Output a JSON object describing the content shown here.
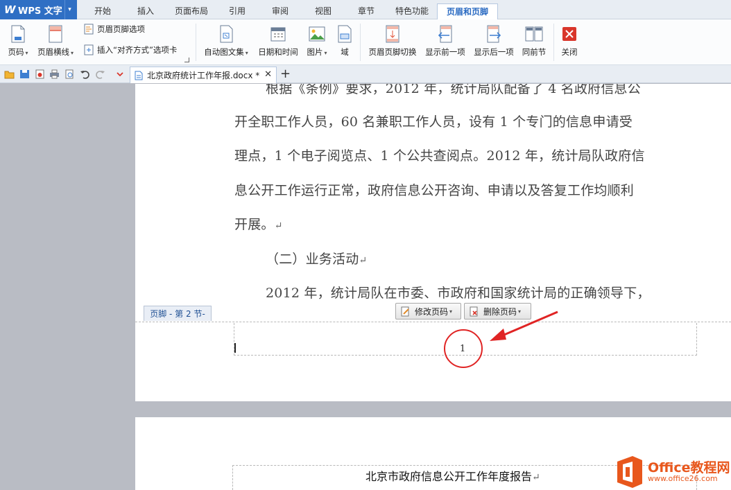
{
  "app": {
    "name": "WPS 文字"
  },
  "menu": {
    "tabs": [
      "开始",
      "插入",
      "页面布局",
      "引用",
      "审阅",
      "视图",
      "章节",
      "特色功能",
      "页眉和页脚"
    ],
    "active": "页眉和页脚"
  },
  "ribbon": {
    "page_number": "页码",
    "header_line": "页眉横线",
    "header_footer_options": "页眉页脚选项",
    "insert_align_tab": "插入“对齐方式”选项卡",
    "auto_text": "自动图文集",
    "date_time": "日期和时间",
    "picture": "图片",
    "field": "域",
    "switch_header_footer": "页眉页脚切换",
    "show_previous": "显示前一项",
    "show_next": "显示后一项",
    "same_as_previous": "同前节",
    "close": "关闭"
  },
  "document_tab": {
    "filename": "北京政府统计工作年报.docx *"
  },
  "document": {
    "lines": [
      "根据《条例》要求，2012 年，统计局队配备了 4 名政府信息公",
      "开全职工作人员，60 名兼职工作人员，设有 1 个专门的信息申请受",
      "理点，1 个电子阅览点、1 个公共查阅点。2012 年，统计局队政府信",
      "息公开工作运行正常，政府信息公开咨询、申请以及答复工作均顺利",
      "开展。"
    ],
    "subheading": "（二）业务活动",
    "line_after": "2012 年，统计局队在市委、市政府和国家统计局的正确领导下，",
    "para_mark": "↵"
  },
  "footer": {
    "label": "页脚  - 第 2 节-",
    "modify_page_number": "修改页码",
    "delete_page_number": "删除页码",
    "page_number_value": "1"
  },
  "page2": {
    "title": "北京市政府信息公开工作年度报告"
  },
  "watermark": {
    "title": "Office教程网",
    "url": "www.office26.com"
  }
}
